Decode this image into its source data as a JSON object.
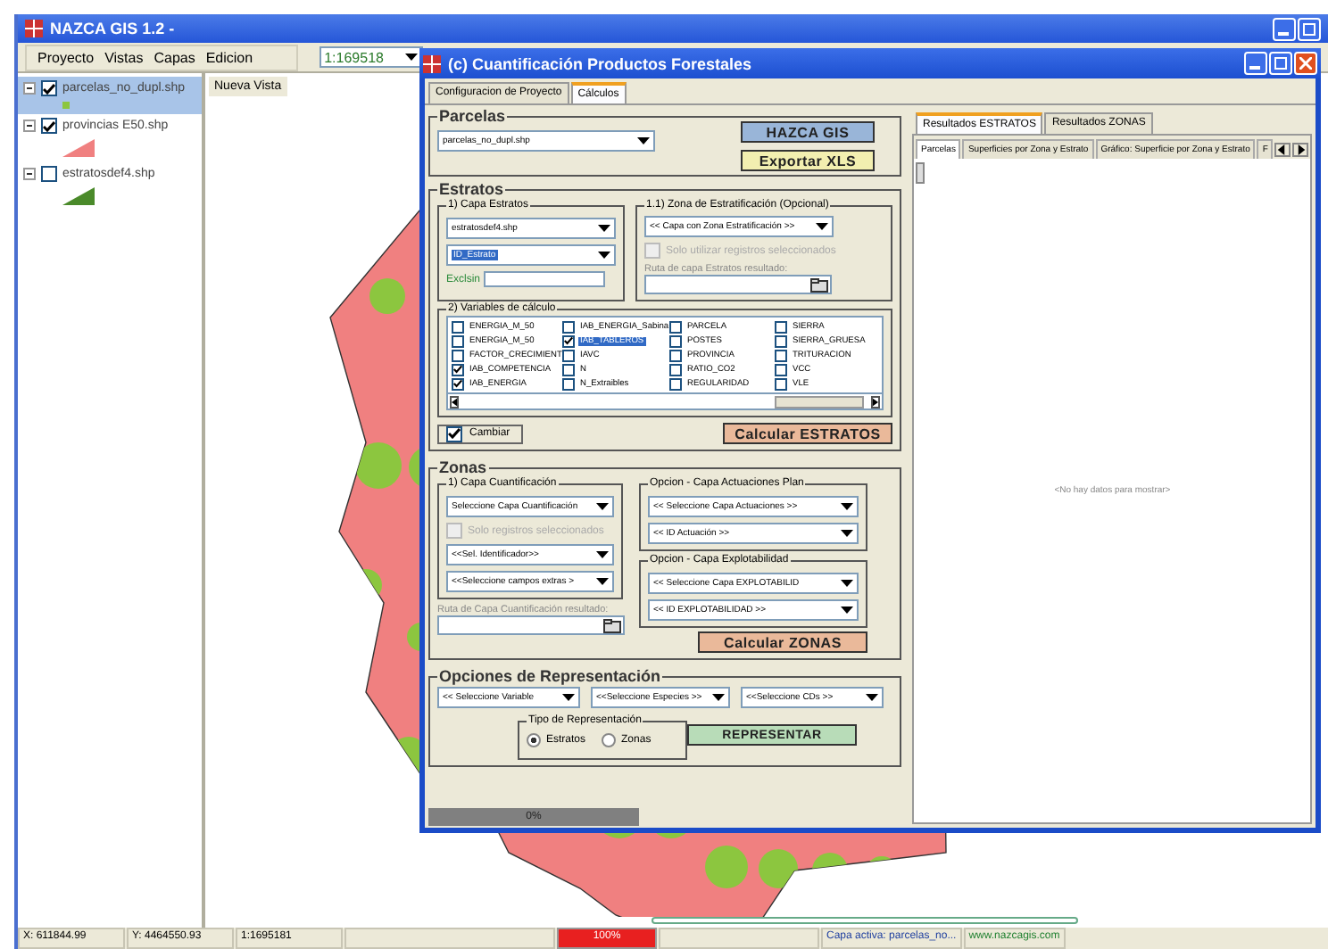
{
  "window": {
    "title": "NAZCA GIS 1.2 -"
  },
  "menu": [
    "Proyecto",
    "Vistas",
    "Capas",
    "Edicion"
  ],
  "scale": "1:169518",
  "layers": [
    {
      "name": "parcelas_no_dupl.shp",
      "checked": true,
      "selected": true,
      "kind": "point",
      "color": "#8cc63f"
    },
    {
      "name": "provincias E50.shp",
      "checked": true,
      "selected": false,
      "kind": "polygon",
      "color": "#f08080"
    },
    {
      "name": "estratosdef4.shp",
      "checked": false,
      "selected": false,
      "kind": "polygon",
      "color": "#4a8a2a"
    }
  ],
  "view_tab": "Nueva Vista",
  "dialog": {
    "title": "(c)  Cuantificación Productos Forestales",
    "tabs": [
      {
        "label": "Configuracion de Proyecto",
        "selected": false
      },
      {
        "label": "Cálculos",
        "selected": true
      }
    ],
    "parcelas": {
      "title": "Parcelas",
      "layer": "parcelas_no_dupl.shp",
      "hazca_button": "HAZCA GIS",
      "export_button": "Exportar XLS"
    },
    "estratos": {
      "title": "Estratos",
      "capa_title": "1) Capa Estratos",
      "layer": "estratosdef4.shp",
      "field": "ID_Estrato",
      "exclusion_label": "Exclsin",
      "zona_title": "1.1) Zona de Estratificación (Opcional)",
      "zona_combo": "<< Capa con Zona Estratificación >>",
      "solo_check": {
        "label": "Solo utilizar registros seleccionados",
        "checked": false,
        "disabled": true
      },
      "path_label": "Ruta de capa Estratos resultado:",
      "variables_title": "2) Variables de cálculo",
      "variables": [
        {
          "label": "ENERGIA_M_50",
          "checked": false,
          "selected": false
        },
        {
          "label": "ENERGIA_M_50",
          "checked": false,
          "selected": false
        },
        {
          "label": "FACTOR_CRECIMIENT",
          "checked": false,
          "selected": false
        },
        {
          "label": "IAB_COMPETENCIA",
          "checked": true,
          "selected": false
        },
        {
          "label": "IAB_ENERGIA",
          "checked": true,
          "selected": false
        },
        {
          "label": "IAB_ENERGIA_Sabina",
          "checked": false,
          "selected": false
        },
        {
          "label": "IAB_TABLEROS",
          "checked": true,
          "selected": true
        },
        {
          "label": "IAVC",
          "checked": false,
          "selected": false
        },
        {
          "label": "N",
          "checked": false,
          "selected": false
        },
        {
          "label": "N_Extraibles",
          "checked": false,
          "selected": false
        },
        {
          "label": "PARCELA",
          "checked": false,
          "selected": false
        },
        {
          "label": "POSTES",
          "checked": false,
          "selected": false
        },
        {
          "label": "PROVINCIA",
          "checked": false,
          "selected": false
        },
        {
          "label": "RATIO_CO2",
          "checked": false,
          "selected": false
        },
        {
          "label": "REGULARIDAD",
          "checked": false,
          "selected": false
        },
        {
          "label": "SIERRA",
          "checked": false,
          "selected": false
        },
        {
          "label": "SIERRA_GRUESA",
          "checked": false,
          "selected": false
        },
        {
          "label": "TRITURACION",
          "checked": false,
          "selected": false
        },
        {
          "label": "VCC",
          "checked": false,
          "selected": false
        },
        {
          "label": "VLE",
          "checked": false,
          "selected": false
        }
      ],
      "cambiar": {
        "label": "Cambiar",
        "checked": true
      },
      "calc_button": "Calcular ESTRATOS"
    },
    "zonas": {
      "title": "Zonas",
      "capa_title": "1) Capa Cuantificación",
      "capa_combo": "Seleccione Capa Cuantificación",
      "solo_check": {
        "label": "Solo registros seleccionados",
        "checked": false,
        "disabled": true
      },
      "id_combo": "<<Sel. Identificador>>",
      "extras_combo": "<<Seleccione campos extras >",
      "path_label": "Ruta de Capa Cuantificación resultado:",
      "actuaciones_title": "Opcion - Capa Actuaciones Plan",
      "actuaciones_combo": "<< Seleccione Capa Actuaciones >>",
      "actuacion_id_combo": "<< ID Actuación >>",
      "explot_title": "Opcion - Capa Explotabilidad",
      "explot_combo": "<< Seleccione Capa EXPLOTABILID",
      "explot_id_combo": "<< ID EXPLOTABILIDAD >>",
      "calc_button": "Calcular ZONAS"
    },
    "representacion": {
      "title": "Opciones de Representación",
      "variable_combo": "<< Seleccione Variable",
      "especies_combo": "<<Seleccione Especies >>",
      "cds_combo": "<<Seleccione CDs >>",
      "tipo_title": "Tipo de Representación",
      "tipos": [
        {
          "label": "Estratos",
          "selected": true
        },
        {
          "label": "Zonas",
          "selected": false
        }
      ],
      "button": "REPRESENTAR"
    },
    "progress": {
      "text": "0%",
      "level": 0
    },
    "results": {
      "tabs": [
        {
          "label": "Resultados ESTRATOS",
          "selected": true
        },
        {
          "label": "Resultados ZONAS",
          "selected": false
        }
      ],
      "subtabs": [
        {
          "label": "Parcelas",
          "selected": true
        },
        {
          "label": "Superficies por Zona y Estrato",
          "selected": false
        },
        {
          "label": "Gráfico: Superficie por Zona y Estrato",
          "selected": false
        },
        {
          "label": "F",
          "selected": false
        }
      ],
      "empty": "<No hay datos para mostrar>"
    }
  },
  "status_bar": {
    "x": "X: 611844.99",
    "y": "Y: 4464550.93",
    "scale": "1:1695181",
    "progress": {
      "text": "100%",
      "level": 1
    },
    "active_layer": "Capa activa: parcelas_no...",
    "website": "www.nazcagis.com"
  }
}
